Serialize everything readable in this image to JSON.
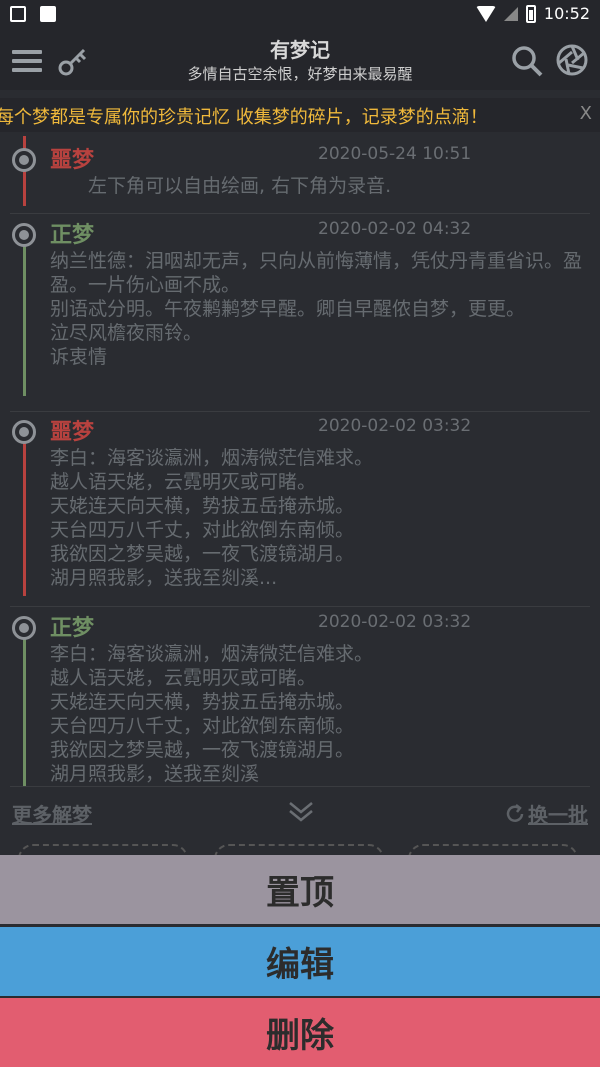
{
  "status_bar": {
    "time": "10:52"
  },
  "header": {
    "title": "有梦记",
    "subtitle": "多情自古空余恨，好梦由来最易醒"
  },
  "marquee": {
    "text": "每个梦都是专属你的珍贵记忆 收集梦的碎片，记录梦的点滴！",
    "close": "X"
  },
  "entries": [
    {
      "type": "噩梦",
      "date": "2020-05-24 10:51",
      "content": "　　左下角可以自由绘画, 右下角为录音."
    },
    {
      "type": "正梦",
      "date": "2020-02-02 04:32",
      "content": "纳兰性德：泪咽却无声，只向从前悔薄情，凭仗丹青重省识。盈盈。一片伤心画不成。\n别语忒分明。午夜鹣鹣梦早醒。卿自早醒侬自梦，更更。\n泣尽风檐夜雨铃。\n诉衷情"
    },
    {
      "type": "噩梦",
      "date": "2020-02-02 03:32",
      "content": "李白：海客谈瀛洲，烟涛微茫信难求。\n越人语天姥，云霓明灭或可睹。\n天姥连天向天横，势拔五岳掩赤城。\n天台四万八千丈，对此欲倒东南倾。\n我欲因之梦吴越，一夜飞渡镜湖月。\n湖月照我影，送我至剡溪..."
    },
    {
      "type": "正梦",
      "date": "2020-02-02 03:32",
      "content": "李白：海客谈瀛洲，烟涛微茫信难求。\n越人语天姥，云霓明灭或可睹。\n天姥连天向天横，势拔五岳掩赤城。\n天台四万八千丈，对此欲倒东南倾。\n我欲因之梦吴越，一夜飞渡镜湖月。\n湖月照我影，送我至剡溪"
    }
  ],
  "footer": {
    "more_label": "更多解梦",
    "refresh_label": "换一批"
  },
  "actions": {
    "pin": "置顶",
    "edit": "编辑",
    "delete": "删除"
  },
  "colors": {
    "nightmare": "#b8423f",
    "good_dream": "#6f8f63",
    "pin_bg": "#9b949f",
    "edit_bg": "#4b9fd8",
    "delete_bg": "#e25d70",
    "marquee_text": "#f0b93b"
  }
}
